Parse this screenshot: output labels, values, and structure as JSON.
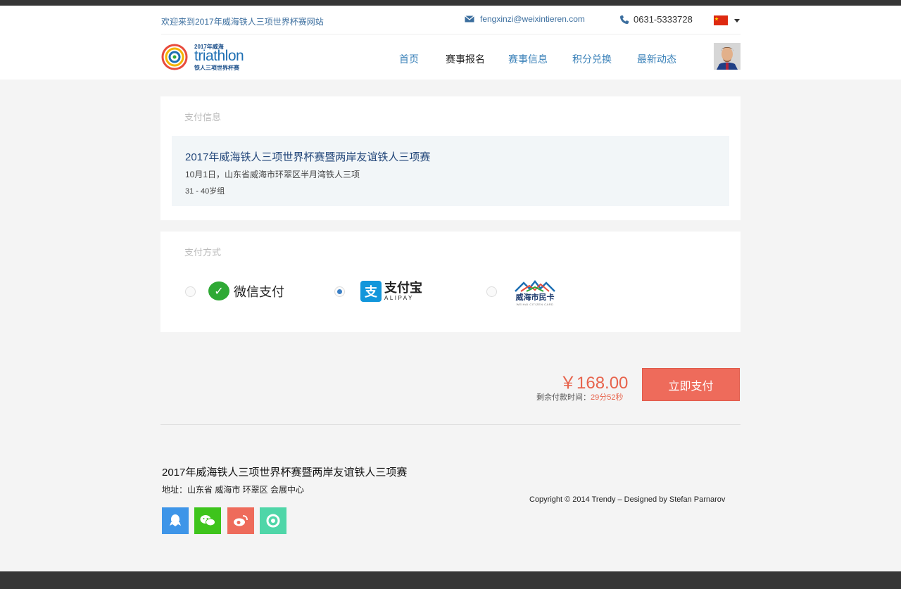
{
  "header": {
    "welcome": "欢迎来到2017年威海铁人三项世界杯赛网站",
    "email": "fengxinzi@weixintieren.com",
    "phone": "0631-5333728",
    "logo": {
      "year": "2017年威海",
      "name": "triathlon",
      "sub": "铁人三项世界杯赛"
    },
    "nav": [
      "首页",
      "赛事报名",
      "赛事信息",
      "积分兑换",
      "最新动态"
    ],
    "active_nav": "赛事报名"
  },
  "payment_info": {
    "title": "支付信息",
    "event_name": "2017年威海铁人三项世界杯赛暨两岸友谊铁人三项赛",
    "event_date_location": "10月1日，山东省威海市环翠区半月湾铁人三项",
    "age_group": "31 - 40岁组"
  },
  "payment_method": {
    "title": "支付方式",
    "wechat_label": "微信支付",
    "alipay_label": "支付宝",
    "alipay_sub": "ALIPAY",
    "weihai_card_label": "威海市民卡",
    "weihai_card_sub": "WEIHAI CITIZEN CARD",
    "selected": "alipay"
  },
  "order": {
    "price": "￥168.00",
    "timer_label": "剩余付款时间：",
    "timer_value": "29分52秒",
    "pay_button": "立即支付"
  },
  "footer": {
    "title": "2017年威海铁人三项世界杯赛暨两岸友谊铁人三项赛",
    "address": "地址：山东省 威海市 环翠区 会展中心",
    "copyright": "Copyright © 2014 Trendy – Designed by Stefan Parnarov",
    "social": [
      "qq-icon",
      "wechat-icon",
      "weibo-icon",
      "moments-icon"
    ]
  },
  "colors": {
    "accent": "#ee6b5b",
    "link": "#3b82b9",
    "qq": "#3e95e8",
    "wechat": "#3ec41c",
    "weibo": "#ee6b5b",
    "moments": "#4fd6a8"
  }
}
